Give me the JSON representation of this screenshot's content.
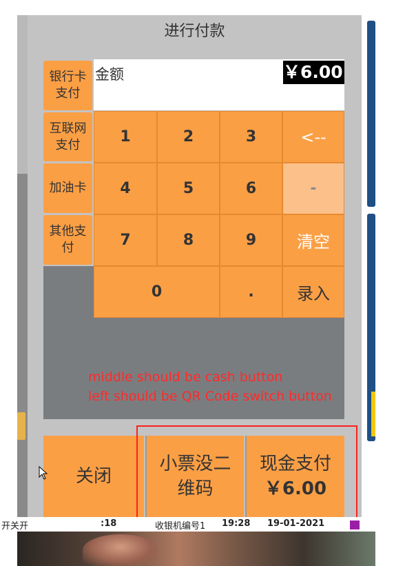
{
  "dialog": {
    "title": "进行付款"
  },
  "methods": [
    {
      "label": "银行卡支付"
    },
    {
      "label": "互联网支付"
    },
    {
      "label": "加油卡"
    },
    {
      "label": "其他支付"
    }
  ],
  "amount": {
    "label": "金额",
    "value": "￥6.00"
  },
  "keypad": {
    "k1": "1",
    "k2": "2",
    "k3": "3",
    "backspace": "<--",
    "k4": "4",
    "k5": "5",
    "k6": "6",
    "minus": "-",
    "k7": "7",
    "k8": "8",
    "k9": "9",
    "clear": "清空",
    "k0": "0",
    "dot": ".",
    "enter": "录入"
  },
  "annotations": {
    "line1": "middle should be cash button",
    "line2": "left should be QR Code switch button"
  },
  "bottom": {
    "close": "关闭",
    "receipt_qr_line1": "小票没二",
    "receipt_qr_line2": "维码",
    "cash_line1": "现金支付",
    "cash_line2": "￥6.00"
  },
  "statusbar": {
    "left": "开关开",
    "time_fragment": ":18",
    "register_label": "收银机编号1",
    "clock": "19:28",
    "date": "19-01-2021"
  },
  "colors": {
    "button": "#fb9f45",
    "dialog": "#c3c3c3",
    "keypad_bg": "#7a7d80",
    "annotation": "#ff2a2a"
  }
}
